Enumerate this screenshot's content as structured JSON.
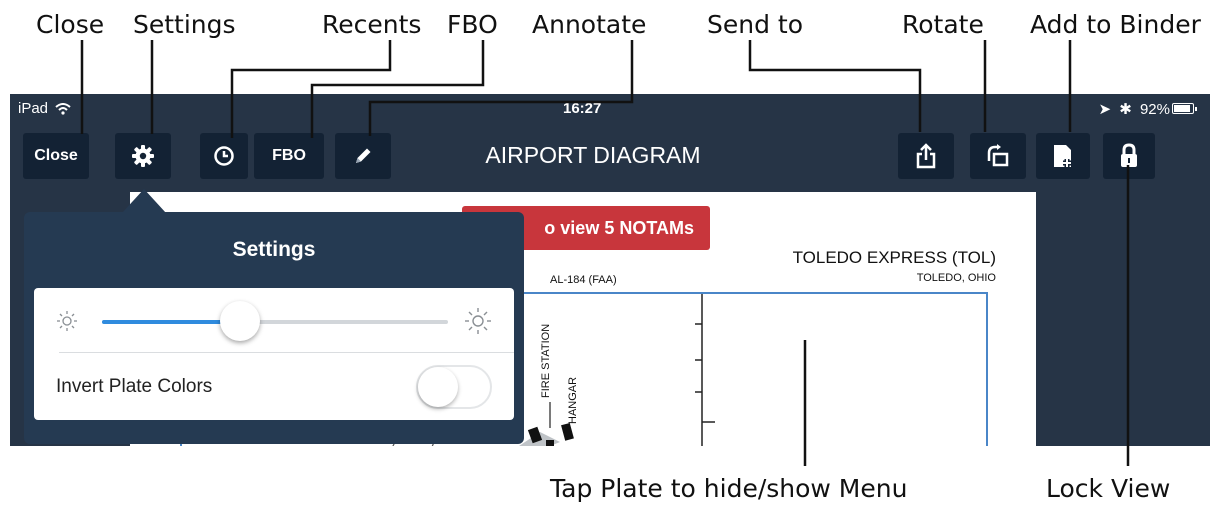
{
  "callouts": {
    "close": "Close",
    "settings": "Settings",
    "recents": "Recents",
    "fbo": "FBO",
    "annotate": "Annotate",
    "send_to": "Send to",
    "rotate": "Rotate",
    "add_to_binder": "Add to Binder",
    "tap_plate": "Tap Plate to hide/show Menu",
    "lock_view": "Lock View"
  },
  "status_bar": {
    "device": "iPad",
    "time": "16:27",
    "battery": "92%"
  },
  "toolbar": {
    "close_label": "Close",
    "fbo_label": "FBO",
    "title": "AIRPORT DIAGRAM"
  },
  "icons": {
    "wifi": "wifi-icon",
    "gear": "gear-icon",
    "clock": "clock-icon",
    "pencil": "pencil-icon",
    "share": "share-icon",
    "rotate": "rotate-icon",
    "add_binder": "add-to-binder-icon",
    "lock": "lock-icon",
    "brightness_low": "brightness-low-icon",
    "brightness_high": "brightness-high-icon"
  },
  "plate": {
    "notam_button": "o view 5 NOTAMs",
    "airport_name": "TOLEDO EXPRESS (TOL)",
    "city": "TOLEDO, OHIO",
    "chart_code": "AL-184 (FAA)",
    "labels": [
      "FIRE STATION",
      "HANGAR"
    ]
  },
  "settings_popover": {
    "title": "Settings",
    "brightness_level": 0.4,
    "invert_label": "Invert Plate Colors",
    "invert_on": false
  },
  "colors": {
    "navbar": "#263446",
    "button": "#132234",
    "notam": "#c8363c",
    "popover": "#253a52",
    "slider_fill": "#2f8bde",
    "plate_frame": "#4a86c8"
  }
}
